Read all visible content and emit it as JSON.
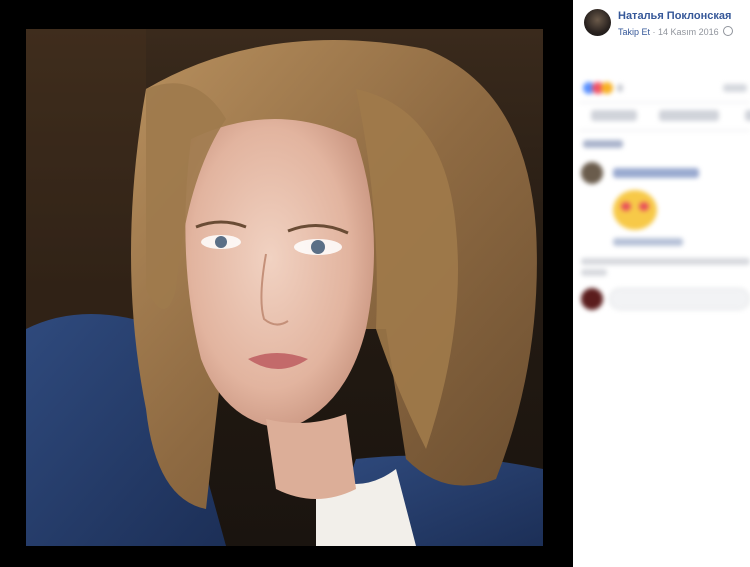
{
  "post": {
    "author_name": "Наталья Поклонская",
    "follow_label": "Takip Et",
    "separator": "·",
    "date": "14 Kasım 2016"
  },
  "icons": {
    "privacy": "globe-icon"
  },
  "colors": {
    "link": "#365899",
    "meta": "#90949c",
    "viewer_background": "#000000",
    "panel_background": "#ffffff"
  }
}
